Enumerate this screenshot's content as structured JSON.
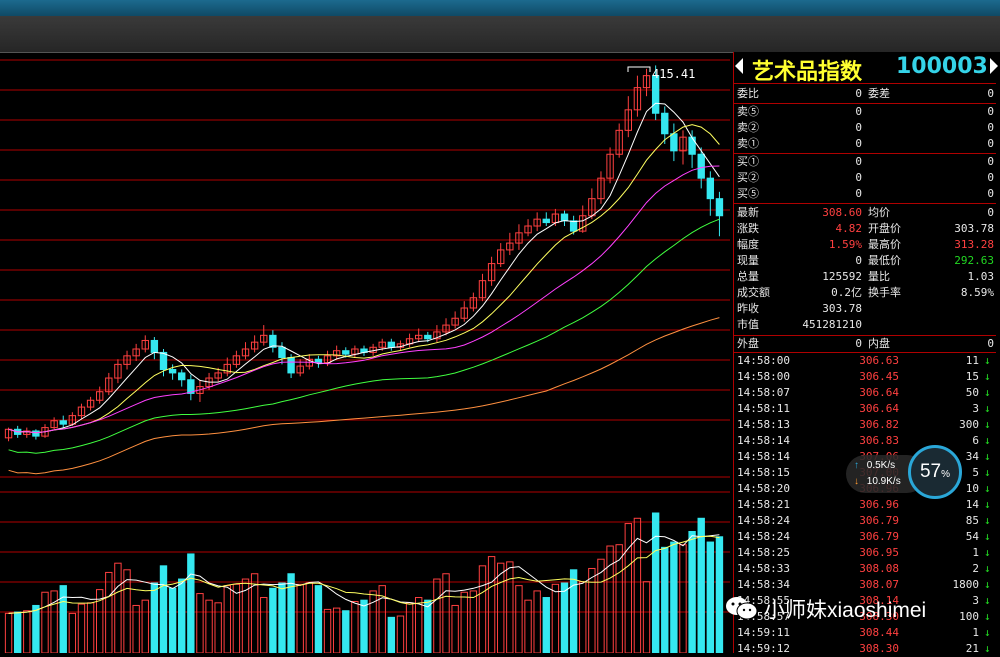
{
  "stock": {
    "name": "艺术品指数",
    "code": "100003",
    "peak_label": "415.41"
  },
  "quote": {
    "rows": [
      {
        "l1": "委比",
        "v1": "0",
        "l2": "委差",
        "v2": "0"
      },
      {
        "l1": "卖⑤",
        "v1": "0",
        "l2": "",
        "v2": "0"
      },
      {
        "l1": "卖②",
        "v1": "0",
        "l2": "",
        "v2": "0"
      },
      {
        "l1": "卖①",
        "v1": "0",
        "l2": "",
        "v2": "0"
      },
      {
        "l1": "买①",
        "v1": "0",
        "l2": "",
        "v2": "0"
      },
      {
        "l1": "买②",
        "v1": "0",
        "l2": "",
        "v2": "0"
      },
      {
        "l1": "买⑤",
        "v1": "0",
        "l2": "",
        "v2": "0"
      }
    ],
    "stats": [
      {
        "l1": "最新",
        "v1": "308.60",
        "c1": "r",
        "l2": "均价",
        "v2": "0",
        "c2": "w"
      },
      {
        "l1": "涨跌",
        "v1": "4.82",
        "c1": "r",
        "l2": "开盘价",
        "v2": "303.78",
        "c2": "w"
      },
      {
        "l1": "幅度",
        "v1": "1.59%",
        "c1": "r",
        "l2": "最高价",
        "v2": "313.28",
        "c2": "r"
      },
      {
        "l1": "现量",
        "v1": "0",
        "c1": "w",
        "l2": "最低价",
        "v2": "292.63",
        "c2": "g"
      },
      {
        "l1": "总量",
        "v1": "125592",
        "c1": "w",
        "l2": "量比",
        "v2": "1.03",
        "c2": "w"
      },
      {
        "l1": "成交额",
        "v1": "0.2亿",
        "c1": "w",
        "l2": "换手率",
        "v2": "8.59%",
        "c2": "w"
      },
      {
        "l1": "昨收",
        "v1": "303.78",
        "c1": "w",
        "l2": "",
        "v2": "",
        "c2": "w"
      },
      {
        "l1": "市值",
        "v1": "451281210",
        "c1": "w",
        "l2": "",
        "v2": "",
        "c2": "w"
      }
    ],
    "outer": {
      "l1": "外盘",
      "v1": "0",
      "l2": "内盘",
      "v2": "0"
    }
  },
  "ticks": [
    {
      "t": "14:58:00",
      "p": "306.63",
      "v": "11"
    },
    {
      "t": "14:58:00",
      "p": "306.45",
      "v": "15"
    },
    {
      "t": "14:58:07",
      "p": "306.64",
      "v": "50"
    },
    {
      "t": "14:58:11",
      "p": "306.64",
      "v": "3"
    },
    {
      "t": "14:58:13",
      "p": "306.82",
      "v": "300"
    },
    {
      "t": "14:58:14",
      "p": "306.83",
      "v": "6"
    },
    {
      "t": "14:58:14",
      "p": "307.06",
      "v": "34"
    },
    {
      "t": "14:58:15",
      "p": "307.00",
      "v": "5"
    },
    {
      "t": "14:58:20",
      "p": "306.96",
      "v": "10"
    },
    {
      "t": "14:58:21",
      "p": "306.96",
      "v": "14"
    },
    {
      "t": "14:58:24",
      "p": "306.79",
      "v": "85"
    },
    {
      "t": "14:58:24",
      "p": "306.79",
      "v": "54"
    },
    {
      "t": "14:58:25",
      "p": "306.95",
      "v": "1"
    },
    {
      "t": "14:58:33",
      "p": "308.08",
      "v": "2"
    },
    {
      "t": "14:58:34",
      "p": "308.07",
      "v": "1800"
    },
    {
      "t": "14:58:55",
      "p": "308.14",
      "v": "3"
    },
    {
      "t": "14:58:57",
      "p": "308.30",
      "v": "100"
    },
    {
      "t": "14:59:11",
      "p": "308.44",
      "v": "1"
    },
    {
      "t": "14:59:12",
      "p": "308.30",
      "v": "21"
    }
  ],
  "speed": {
    "up": "0.5K/s",
    "down": "10.9K/s",
    "percent": "57",
    "unit": "%"
  },
  "watermark": "小师妹xiaoshimei",
  "colors": {
    "up": "#ff4040",
    "down": "#35e8f0",
    "grid": "#b00000",
    "ma5": "#ffffff",
    "ma10": "#ffff60",
    "ma20": "#ff40ff",
    "ma30": "#40ff40",
    "ma60": "#ff9040"
  },
  "chart_data": {
    "type": "candlestick",
    "series": [
      {
        "o": 300,
        "c": 305,
        "h": 306,
        "l": 298
      },
      {
        "o": 305,
        "c": 302,
        "h": 307,
        "l": 300
      },
      {
        "o": 302,
        "c": 304,
        "h": 306,
        "l": 300
      },
      {
        "o": 304,
        "c": 301,
        "h": 305,
        "l": 299
      },
      {
        "o": 301,
        "c": 306,
        "h": 308,
        "l": 300
      },
      {
        "o": 306,
        "c": 310,
        "h": 312,
        "l": 305
      },
      {
        "o": 310,
        "c": 308,
        "h": 313,
        "l": 306
      },
      {
        "o": 308,
        "c": 313,
        "h": 315,
        "l": 307
      },
      {
        "o": 313,
        "c": 318,
        "h": 320,
        "l": 311
      },
      {
        "o": 318,
        "c": 322,
        "h": 324,
        "l": 316
      },
      {
        "o": 322,
        "c": 327,
        "h": 330,
        "l": 320
      },
      {
        "o": 327,
        "c": 335,
        "h": 338,
        "l": 325
      },
      {
        "o": 335,
        "c": 343,
        "h": 346,
        "l": 332
      },
      {
        "o": 343,
        "c": 348,
        "h": 351,
        "l": 340
      },
      {
        "o": 348,
        "c": 352,
        "h": 355,
        "l": 345
      },
      {
        "o": 352,
        "c": 357,
        "h": 360,
        "l": 350
      },
      {
        "o": 357,
        "c": 350,
        "h": 359,
        "l": 346
      },
      {
        "o": 350,
        "c": 340,
        "h": 352,
        "l": 336
      },
      {
        "o": 340,
        "c": 338,
        "h": 343,
        "l": 334
      },
      {
        "o": 338,
        "c": 334,
        "h": 340,
        "l": 330
      },
      {
        "o": 334,
        "c": 326,
        "h": 337,
        "l": 322
      },
      {
        "o": 326,
        "c": 330,
        "h": 334,
        "l": 321
      },
      {
        "o": 330,
        "c": 335,
        "h": 338,
        "l": 328
      },
      {
        "o": 335,
        "c": 338,
        "h": 341,
        "l": 333
      },
      {
        "o": 338,
        "c": 343,
        "h": 347,
        "l": 336
      },
      {
        "o": 343,
        "c": 348,
        "h": 351,
        "l": 341
      },
      {
        "o": 348,
        "c": 352,
        "h": 356,
        "l": 346
      },
      {
        "o": 352,
        "c": 356,
        "h": 360,
        "l": 350
      },
      {
        "o": 356,
        "c": 360,
        "h": 366,
        "l": 354
      },
      {
        "o": 360,
        "c": 353,
        "h": 363,
        "l": 350
      },
      {
        "o": 353,
        "c": 347,
        "h": 356,
        "l": 343
      },
      {
        "o": 347,
        "c": 338,
        "h": 349,
        "l": 335
      },
      {
        "o": 338,
        "c": 342,
        "h": 346,
        "l": 336
      },
      {
        "o": 342,
        "c": 346,
        "h": 349,
        "l": 340
      },
      {
        "o": 346,
        "c": 344,
        "h": 348,
        "l": 341
      },
      {
        "o": 344,
        "c": 348,
        "h": 351,
        "l": 342
      },
      {
        "o": 348,
        "c": 351,
        "h": 354,
        "l": 346
      },
      {
        "o": 351,
        "c": 349,
        "h": 353,
        "l": 347
      },
      {
        "o": 349,
        "c": 352,
        "h": 354,
        "l": 347
      },
      {
        "o": 352,
        "c": 350,
        "h": 354,
        "l": 348
      },
      {
        "o": 350,
        "c": 353,
        "h": 355,
        "l": 348
      },
      {
        "o": 353,
        "c": 356,
        "h": 358,
        "l": 351
      },
      {
        "o": 356,
        "c": 353,
        "h": 358,
        "l": 351
      },
      {
        "o": 353,
        "c": 355,
        "h": 357,
        "l": 351
      },
      {
        "o": 355,
        "c": 358,
        "h": 361,
        "l": 353
      },
      {
        "o": 358,
        "c": 360,
        "h": 364,
        "l": 356
      },
      {
        "o": 360,
        "c": 358,
        "h": 362,
        "l": 356
      },
      {
        "o": 358,
        "c": 362,
        "h": 366,
        "l": 356
      },
      {
        "o": 362,
        "c": 366,
        "h": 370,
        "l": 360
      },
      {
        "o": 366,
        "c": 370,
        "h": 374,
        "l": 364
      },
      {
        "o": 370,
        "c": 376,
        "h": 380,
        "l": 368
      },
      {
        "o": 376,
        "c": 382,
        "h": 385,
        "l": 374
      },
      {
        "o": 382,
        "c": 392,
        "h": 396,
        "l": 380
      },
      {
        "o": 392,
        "c": 402,
        "h": 406,
        "l": 389
      },
      {
        "o": 402,
        "c": 410,
        "h": 414,
        "l": 400
      },
      {
        "o": 410,
        "c": 414,
        "h": 420,
        "l": 407
      },
      {
        "o": 414,
        "c": 420,
        "h": 425,
        "l": 410
      },
      {
        "o": 420,
        "c": 424,
        "h": 428,
        "l": 418
      },
      {
        "o": 424,
        "c": 428,
        "h": 432,
        "l": 421
      },
      {
        "o": 428,
        "c": 426,
        "h": 432,
        "l": 424
      },
      {
        "o": 426,
        "c": 431,
        "h": 434,
        "l": 424
      },
      {
        "o": 431,
        "c": 427,
        "h": 433,
        "l": 424
      },
      {
        "o": 427,
        "c": 421,
        "h": 430,
        "l": 419
      },
      {
        "o": 421,
        "c": 430,
        "h": 436,
        "l": 420
      },
      {
        "o": 430,
        "c": 440,
        "h": 446,
        "l": 428
      },
      {
        "o": 440,
        "c": 452,
        "h": 456,
        "l": 437
      },
      {
        "o": 452,
        "c": 466,
        "h": 470,
        "l": 449
      },
      {
        "o": 466,
        "c": 480,
        "h": 484,
        "l": 464
      },
      {
        "o": 480,
        "c": 492,
        "h": 500,
        "l": 476
      },
      {
        "o": 492,
        "c": 505,
        "h": 512,
        "l": 488
      },
      {
        "o": 505,
        "c": 512,
        "h": 516,
        "l": 500
      },
      {
        "o": 512,
        "c": 490,
        "h": 518,
        "l": 486
      },
      {
        "o": 490,
        "c": 478,
        "h": 494,
        "l": 472
      },
      {
        "o": 478,
        "c": 468,
        "h": 484,
        "l": 462
      },
      {
        "o": 468,
        "c": 476,
        "h": 480,
        "l": 460
      },
      {
        "o": 476,
        "c": 466,
        "h": 480,
        "l": 458
      },
      {
        "o": 466,
        "c": 452,
        "h": 470,
        "l": 446
      },
      {
        "o": 452,
        "c": 440,
        "h": 456,
        "l": 430
      },
      {
        "o": 440,
        "c": 430,
        "h": 444,
        "l": 418
      }
    ]
  }
}
